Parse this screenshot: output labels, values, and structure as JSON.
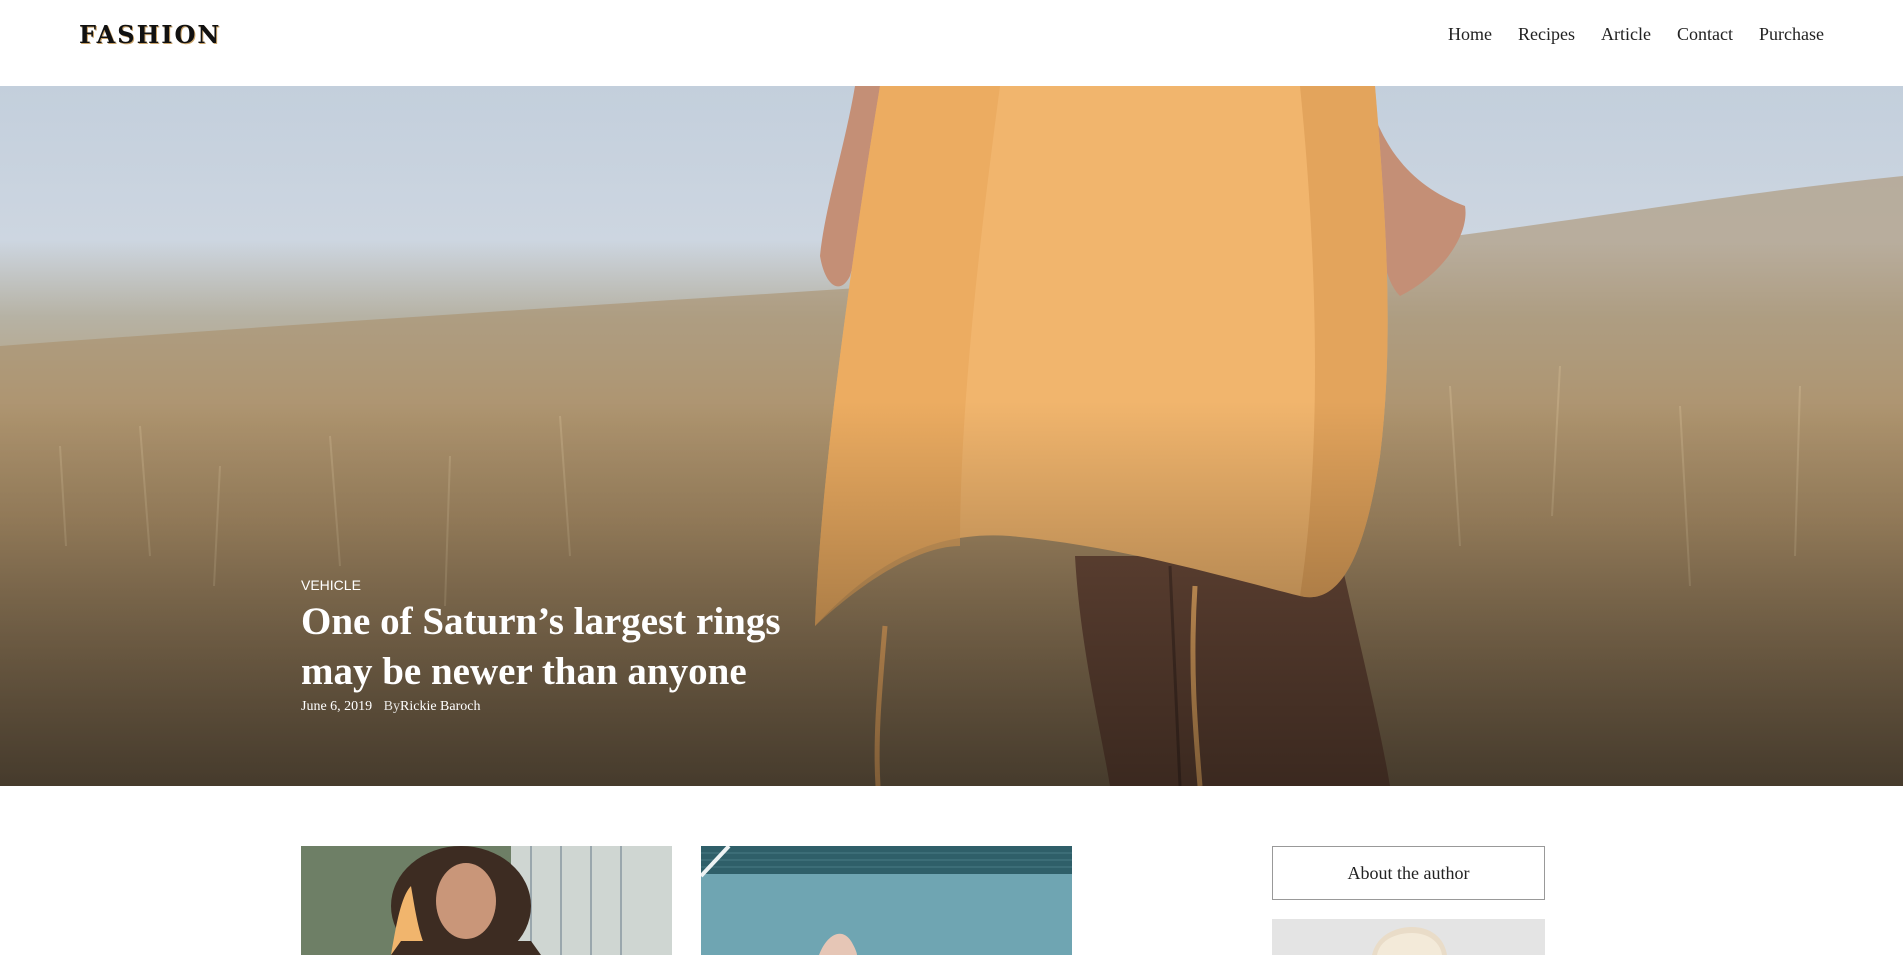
{
  "header": {
    "logo": "FASHION",
    "nav": [
      "Home",
      "Recipes",
      "Article",
      "Contact",
      "Purchase"
    ]
  },
  "hero": {
    "category": "VEHICLE",
    "headline": "One of Saturn’s largest rings may be newer than anyone",
    "date": "June 6, 2019",
    "by_prefix": "By",
    "author": "Rickie Baroch"
  },
  "sidebar": {
    "about_title": "About the author"
  },
  "colors": {
    "accent": "#c9a36a",
    "dress": "#f1b56d",
    "text": "#222222"
  }
}
